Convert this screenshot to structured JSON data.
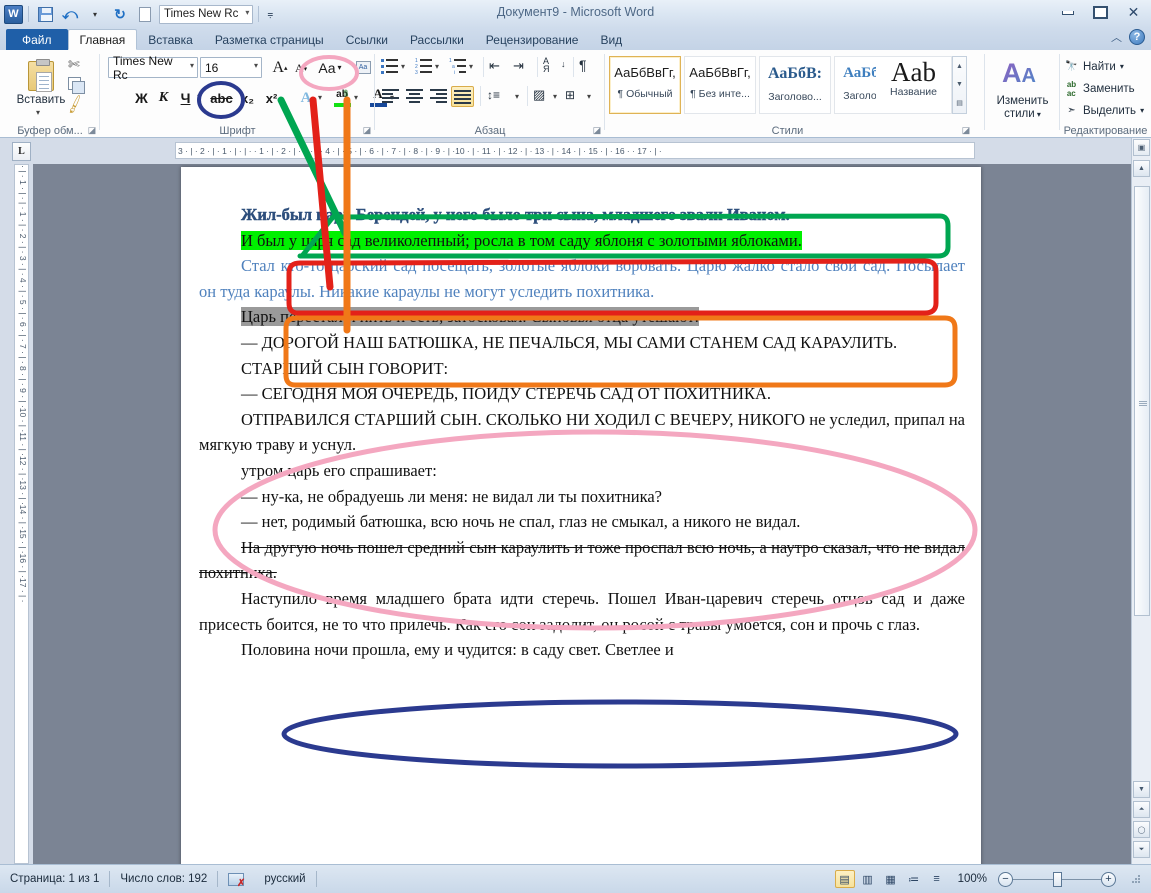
{
  "titlebar": {
    "app_icon": "word-logo",
    "document_title": "Документ9  -  Microsoft Word",
    "quick_access": [
      {
        "name": "save",
        "icon": "save-icon"
      },
      {
        "name": "undo",
        "icon": "undo-icon",
        "glyph": "↰"
      },
      {
        "name": "redo",
        "icon": "redo-icon",
        "glyph": "↻"
      },
      {
        "name": "new",
        "icon": "new-document-icon"
      }
    ],
    "qat_font_value": "Times New Rc",
    "window_buttons": {
      "minimize": "—",
      "maximize": "▫",
      "close": "✕"
    }
  },
  "tabs": [
    {
      "label": "Файл",
      "kind": "file"
    },
    {
      "label": "Главная",
      "kind": "active"
    },
    {
      "label": "Вставка",
      "kind": "normal"
    },
    {
      "label": "Разметка страницы",
      "kind": "normal"
    },
    {
      "label": "Ссылки",
      "kind": "normal"
    },
    {
      "label": "Рассылки",
      "kind": "normal"
    },
    {
      "label": "Рецензирование",
      "kind": "normal"
    },
    {
      "label": "Вид",
      "kind": "normal"
    }
  ],
  "help": {
    "minimize_ribbon": "︿",
    "help_label": "?"
  },
  "ribbon": {
    "clipboard": {
      "group_label": "Буфер обм...",
      "paste_label": "Вставить",
      "cut_icon": "scissors-icon",
      "copy_icon": "copy-icon",
      "format_painter_icon": "format-painter-icon",
      "dialog_launcher": "◪"
    },
    "font": {
      "group_label": "Шрифт",
      "font_name": "Times New Rc",
      "font_size": "16",
      "grow_font": "A",
      "shrink_font": "A",
      "change_case": "Aa",
      "clear_formatting": "Aa",
      "bold": "Ж",
      "italic": "К",
      "underline": "Ч",
      "strikethrough": "abc",
      "subscript": "x₂",
      "superscript": "x²",
      "text_effects": "A",
      "highlight": "ab",
      "font_color": "A",
      "dialog_launcher": "◪"
    },
    "paragraph": {
      "group_label": "Абзац",
      "bullets": "bullets-icon",
      "numbering": "numbering-icon",
      "multilevel": "multilevel-list-icon",
      "decrease_indent": "decrease-indent-icon",
      "increase_indent": "increase-indent-icon",
      "sort": "АЯ",
      "show_marks": "¶",
      "align_left": "align-left-icon",
      "align_center": "align-center-icon",
      "align_right": "align-right-icon",
      "align_justify": "align-justify-icon",
      "line_spacing": "line-spacing-icon",
      "shading": "shading-icon",
      "borders": "borders-icon",
      "dialog_launcher": "◪"
    },
    "styles": {
      "group_label": "Стили",
      "items": [
        {
          "preview": "АаБбВвГг,",
          "name": "¶ Обычный",
          "selected": true
        },
        {
          "preview": "АаБбВвГг,",
          "name": "¶ Без инте...",
          "selected": false
        },
        {
          "preview": "АаБбВ:",
          "name": "Заголово...",
          "selected": false,
          "heading": true
        },
        {
          "preview": "АаБбВв",
          "name": "Заголово...",
          "selected": false,
          "heading": true
        },
        {
          "preview": "Aab",
          "name": "Название",
          "selected": false,
          "title": true
        }
      ],
      "dialog_launcher": "◪"
    },
    "change_styles": {
      "label_line1": "Изменить",
      "label_line2": "стили",
      "icon": "change-styles-icon"
    },
    "editing": {
      "group_label": "Редактирование",
      "items": [
        {
          "label": "Найти",
          "icon": "binoculars-icon",
          "has_arrow": true
        },
        {
          "label": "Заменить",
          "icon": "replace-icon",
          "has_arrow": false
        },
        {
          "label": "Выделить",
          "icon": "select-cursor-icon",
          "has_arrow": true
        }
      ]
    }
  },
  "ruler": {
    "tab_stop_button": "L",
    "horizontal_marks": "3 · | · 2 · | · 1 · | · | ·   · 1 · | · 2 · | · 3 · | · 4 · | · 5 · | · 6 · | · 7 · | · 8 · | · 9 · | ·10 · | · 11 · | · 12 · | · 13 · | · 14 · | · 15 · | · 16 ·   · 17 · | ·",
    "vertical_marks": "· | · 1 · | · | · 1 · | · 2 · | · 3 · | · 4 · | · 5 · | · 6 · | · 7 · | · 8 · | · 9 · | ·10 · | ·11 · | ·12 · | ·13 · | ·14 · | ·15 · | ·16 · | ·17 · | ·"
  },
  "document": {
    "paragraphs": [
      {
        "id": "p1",
        "text": "Жил-был царь Берендей, у него было три сына, младшего звали Иваном.",
        "style": "outline-blue-bold",
        "annotation": "green-box"
      },
      {
        "id": "p2",
        "text": "И был у царя сад великолепный; росла в том саду яблоня с золотыми яблоками.",
        "style": "green-highlight",
        "annotation": "red-box"
      },
      {
        "id": "p3",
        "text": "Стал кто-то царский сад посещать, золотые яблоки воровать. Царю жалко стало свой сад. Посылает он туда караулы. Никакие караулы не могут уследить похитника.",
        "style": "blue-font",
        "annotation": "orange-box"
      },
      {
        "id": "p4",
        "text": "Царь перестал и пить и есть, затосковал. Сыновья отца утешают:",
        "style": "gray-highlight",
        "annotation": "none"
      },
      {
        "id": "p5",
        "text": "—   ДОРОГОЙ НАШ БАТЮШКА, НЕ ПЕЧАЛЬСЯ, МЫ САМИ СТАНЕМ САД КАРАУЛИТЬ.",
        "style": "uppercase",
        "annotation": "pink-ellipse"
      },
      {
        "id": "p6",
        "text": "СТАРШИЙ СЫН ГОВОРИТ:",
        "style": "uppercase",
        "annotation": "pink-ellipse"
      },
      {
        "id": "p7",
        "text": "—   СЕГОДНЯ МОЯ ОЧЕРЕДЬ, ПОЙДУ СТЕРЕЧЬ САД ОТ ПОХИТНИКА.",
        "style": "uppercase",
        "annotation": "pink-ellipse"
      },
      {
        "id": "p8",
        "text": "ОТПРАВИЛСЯ СТАРШИЙ СЫН. СКОЛЬКО НИ ХОДИЛ С ВЕЧЕРУ, НИКОГО не уследил, припал на мягкую траву и уснул.",
        "style": "mixed-case",
        "annotation": "pink-ellipse"
      },
      {
        "id": "p9",
        "text": "утром царь его спрашивает:",
        "style": "normal",
        "annotation": "none"
      },
      {
        "id": "p10",
        "text": "—   ну-ка, не обрадуешь ли меня: не видал ли ты похитника?",
        "style": "normal",
        "annotation": "none"
      },
      {
        "id": "p11",
        "text": "—   нет, родимый батюшка, всю ночь не спал, глаз не смыкал, а никого не видал.",
        "style": "normal",
        "annotation": "none"
      },
      {
        "id": "p12",
        "text": "На другую ночь пошел средний сын караулить и тоже проспал всю ночь, а наутро сказал, что не видал похитника.",
        "style": "strikethrough",
        "annotation": "blue-ellipse"
      },
      {
        "id": "p13",
        "text": "Наступило время младшего брата идти стеречь. Пошел Иван-царевич стеречь отцов сад и даже присесть боится, не то что прилечь. Как его сон задолит, он росой с травы умоется, сон и прочь с глаз.",
        "style": "normal",
        "annotation": "none"
      },
      {
        "id": "p14",
        "text": "Половина ночи прошла, ему и чудится: в саду свет. Светлее и",
        "style": "normal",
        "annotation": "none"
      }
    ]
  },
  "annotations": {
    "green": {
      "color": "#00a651",
      "target": "text-effects-button",
      "shape": "box+line"
    },
    "red": {
      "color": "#e32119",
      "target": "highlight-button",
      "shape": "box+line"
    },
    "orange": {
      "color": "#f07818",
      "target": "font-color-button",
      "shape": "box+line"
    },
    "pink": {
      "color": "#f4a7c0",
      "target": "change-case-button",
      "shape": "ellipse"
    },
    "blue": {
      "color": "#2b3a8f",
      "target": "strikethrough-button",
      "shape": "ellipse"
    }
  },
  "status_bar": {
    "page": "Страница: 1 из 1",
    "word_count": "Число слов: 192",
    "language": "русский",
    "spell_icon": "spellcheck-icon",
    "view_buttons": [
      {
        "name": "print-layout",
        "glyph": "▤",
        "selected": true
      },
      {
        "name": "full-screen-reading",
        "glyph": "▥",
        "selected": false
      },
      {
        "name": "web-layout",
        "glyph": "▦",
        "selected": false
      },
      {
        "name": "outline",
        "glyph": "≔",
        "selected": false
      },
      {
        "name": "draft",
        "glyph": "≡",
        "selected": false
      }
    ],
    "zoom_level": "100%",
    "zoom_out": "−",
    "zoom_in": "+"
  }
}
